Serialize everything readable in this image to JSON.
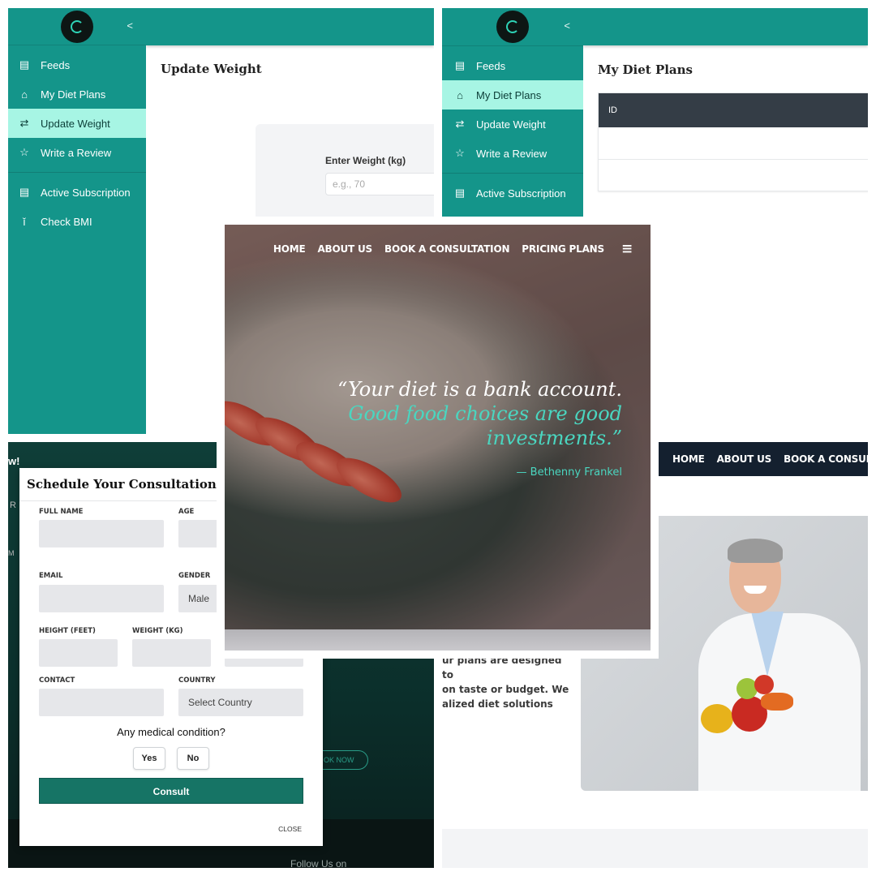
{
  "sidebar": {
    "items": [
      {
        "label": "Feeds",
        "icon": "document-icon"
      },
      {
        "label": "My Diet Plans",
        "icon": "home-icon"
      },
      {
        "label": "Update Weight",
        "icon": "swap-icon"
      },
      {
        "label": "Write a Review",
        "icon": "star-icon"
      },
      {
        "label": "Active Subscription",
        "icon": "file-icon"
      },
      {
        "label": "Check BMI",
        "icon": "person-icon"
      }
    ],
    "collapse_glyph": "<"
  },
  "update_weight": {
    "title": "Update Weight",
    "field_label": "Enter Weight (kg)",
    "placeholder": "e.g., 70"
  },
  "diet_plans": {
    "title": "My Diet Plans",
    "column_header": "ID"
  },
  "hero": {
    "nav": [
      "HOME",
      "ABOUT US",
      "BOOK A CONSULTATION",
      "PRICING PLANS"
    ],
    "quote_line1": "“Your diet is a bank account.",
    "quote_line2": "Good food choices are good",
    "quote_line3": "investments.”",
    "author": "— Bethenny Frankel"
  },
  "consult_modal": {
    "title": "Schedule Your Consultation",
    "labels": {
      "full_name": "FULL NAME",
      "age": "AGE",
      "email": "EMAIL",
      "gender": "GENDER",
      "height": "HEIGHT (FEET)",
      "weight": "WEIGHT (KG)",
      "contact": "CONTACT",
      "country": "COUNTRY"
    },
    "gender_value": "Male",
    "country_value": "Select Country",
    "question": "Any medical condition?",
    "yes": "Yes",
    "no": "No",
    "consult": "Consult",
    "close": "CLOSE",
    "background": {
      "edge_w": "w!",
      "edge_r": "R",
      "edge_m": "M",
      "book_now": "OK NOW",
      "follow": "Follow Us on"
    }
  },
  "landing": {
    "nav": [
      "HOME",
      "ABOUT US",
      "BOOK A CONSULTAT"
    ],
    "text_lines": [
      "ur plans are designed to",
      "on taste or budget. We",
      "alized diet solutions"
    ]
  },
  "colors": {
    "teal": "#14958a",
    "mint_active": "#a7f5e4",
    "quote_accent": "#4ad6c0",
    "consult_button": "#167465",
    "navy_nav": "#14202f"
  }
}
